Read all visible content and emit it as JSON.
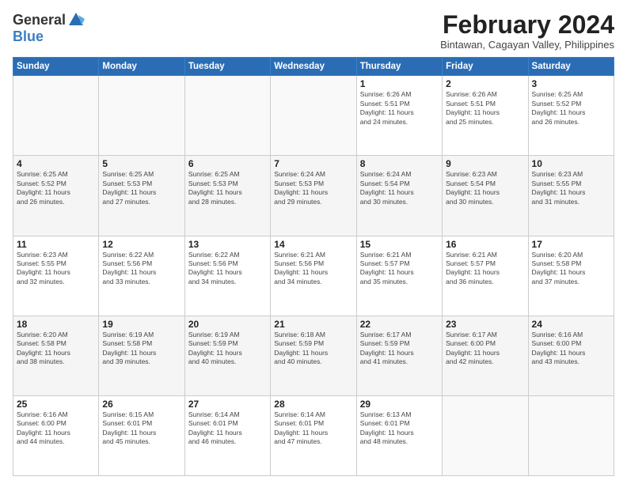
{
  "logo": {
    "general": "General",
    "blue": "Blue"
  },
  "title": {
    "month": "February 2024",
    "location": "Bintawan, Cagayan Valley, Philippines"
  },
  "days_of_week": [
    "Sunday",
    "Monday",
    "Tuesday",
    "Wednesday",
    "Thursday",
    "Friday",
    "Saturday"
  ],
  "weeks": [
    {
      "alt": false,
      "days": [
        {
          "num": "",
          "info": ""
        },
        {
          "num": "",
          "info": ""
        },
        {
          "num": "",
          "info": ""
        },
        {
          "num": "",
          "info": ""
        },
        {
          "num": "1",
          "info": "Sunrise: 6:26 AM\nSunset: 5:51 PM\nDaylight: 11 hours\nand 24 minutes."
        },
        {
          "num": "2",
          "info": "Sunrise: 6:26 AM\nSunset: 5:51 PM\nDaylight: 11 hours\nand 25 minutes."
        },
        {
          "num": "3",
          "info": "Sunrise: 6:25 AM\nSunset: 5:52 PM\nDaylight: 11 hours\nand 26 minutes."
        }
      ]
    },
    {
      "alt": true,
      "days": [
        {
          "num": "4",
          "info": "Sunrise: 6:25 AM\nSunset: 5:52 PM\nDaylight: 11 hours\nand 26 minutes."
        },
        {
          "num": "5",
          "info": "Sunrise: 6:25 AM\nSunset: 5:53 PM\nDaylight: 11 hours\nand 27 minutes."
        },
        {
          "num": "6",
          "info": "Sunrise: 6:25 AM\nSunset: 5:53 PM\nDaylight: 11 hours\nand 28 minutes."
        },
        {
          "num": "7",
          "info": "Sunrise: 6:24 AM\nSunset: 5:53 PM\nDaylight: 11 hours\nand 29 minutes."
        },
        {
          "num": "8",
          "info": "Sunrise: 6:24 AM\nSunset: 5:54 PM\nDaylight: 11 hours\nand 30 minutes."
        },
        {
          "num": "9",
          "info": "Sunrise: 6:23 AM\nSunset: 5:54 PM\nDaylight: 11 hours\nand 30 minutes."
        },
        {
          "num": "10",
          "info": "Sunrise: 6:23 AM\nSunset: 5:55 PM\nDaylight: 11 hours\nand 31 minutes."
        }
      ]
    },
    {
      "alt": false,
      "days": [
        {
          "num": "11",
          "info": "Sunrise: 6:23 AM\nSunset: 5:55 PM\nDaylight: 11 hours\nand 32 minutes."
        },
        {
          "num": "12",
          "info": "Sunrise: 6:22 AM\nSunset: 5:56 PM\nDaylight: 11 hours\nand 33 minutes."
        },
        {
          "num": "13",
          "info": "Sunrise: 6:22 AM\nSunset: 5:56 PM\nDaylight: 11 hours\nand 34 minutes."
        },
        {
          "num": "14",
          "info": "Sunrise: 6:21 AM\nSunset: 5:56 PM\nDaylight: 11 hours\nand 34 minutes."
        },
        {
          "num": "15",
          "info": "Sunrise: 6:21 AM\nSunset: 5:57 PM\nDaylight: 11 hours\nand 35 minutes."
        },
        {
          "num": "16",
          "info": "Sunrise: 6:21 AM\nSunset: 5:57 PM\nDaylight: 11 hours\nand 36 minutes."
        },
        {
          "num": "17",
          "info": "Sunrise: 6:20 AM\nSunset: 5:58 PM\nDaylight: 11 hours\nand 37 minutes."
        }
      ]
    },
    {
      "alt": true,
      "days": [
        {
          "num": "18",
          "info": "Sunrise: 6:20 AM\nSunset: 5:58 PM\nDaylight: 11 hours\nand 38 minutes."
        },
        {
          "num": "19",
          "info": "Sunrise: 6:19 AM\nSunset: 5:58 PM\nDaylight: 11 hours\nand 39 minutes."
        },
        {
          "num": "20",
          "info": "Sunrise: 6:19 AM\nSunset: 5:59 PM\nDaylight: 11 hours\nand 40 minutes."
        },
        {
          "num": "21",
          "info": "Sunrise: 6:18 AM\nSunset: 5:59 PM\nDaylight: 11 hours\nand 40 minutes."
        },
        {
          "num": "22",
          "info": "Sunrise: 6:17 AM\nSunset: 5:59 PM\nDaylight: 11 hours\nand 41 minutes."
        },
        {
          "num": "23",
          "info": "Sunrise: 6:17 AM\nSunset: 6:00 PM\nDaylight: 11 hours\nand 42 minutes."
        },
        {
          "num": "24",
          "info": "Sunrise: 6:16 AM\nSunset: 6:00 PM\nDaylight: 11 hours\nand 43 minutes."
        }
      ]
    },
    {
      "alt": false,
      "days": [
        {
          "num": "25",
          "info": "Sunrise: 6:16 AM\nSunset: 6:00 PM\nDaylight: 11 hours\nand 44 minutes."
        },
        {
          "num": "26",
          "info": "Sunrise: 6:15 AM\nSunset: 6:01 PM\nDaylight: 11 hours\nand 45 minutes."
        },
        {
          "num": "27",
          "info": "Sunrise: 6:14 AM\nSunset: 6:01 PM\nDaylight: 11 hours\nand 46 minutes."
        },
        {
          "num": "28",
          "info": "Sunrise: 6:14 AM\nSunset: 6:01 PM\nDaylight: 11 hours\nand 47 minutes."
        },
        {
          "num": "29",
          "info": "Sunrise: 6:13 AM\nSunset: 6:01 PM\nDaylight: 11 hours\nand 48 minutes."
        },
        {
          "num": "",
          "info": ""
        },
        {
          "num": "",
          "info": ""
        }
      ]
    }
  ]
}
